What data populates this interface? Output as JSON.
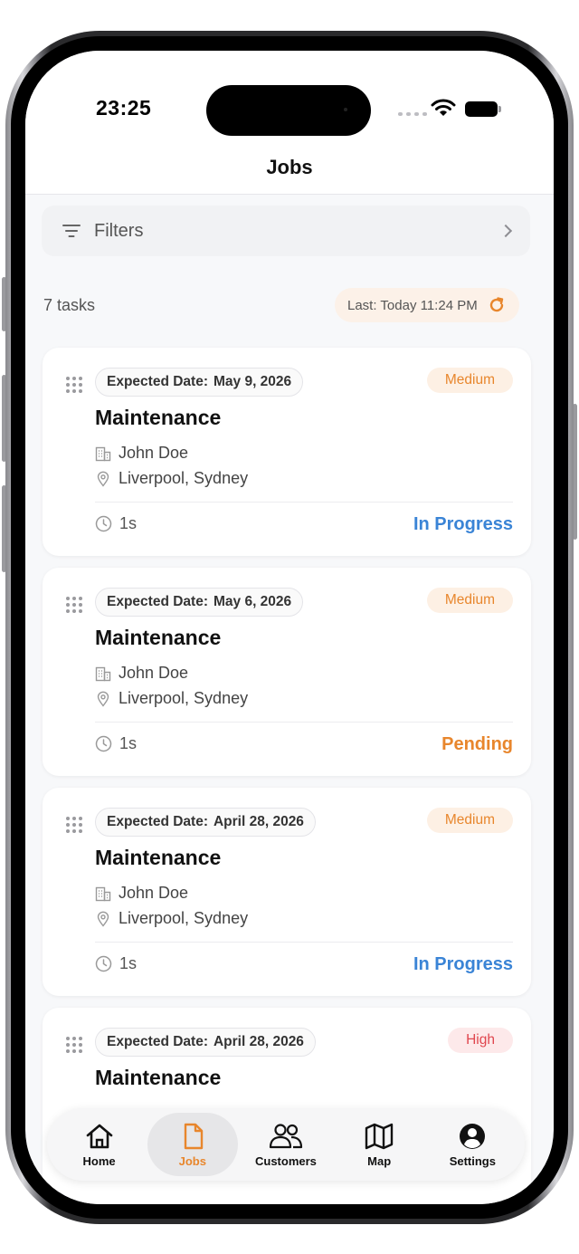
{
  "status_bar": {
    "time": "23:25"
  },
  "nav": {
    "title": "Jobs"
  },
  "filters": {
    "label": "Filters"
  },
  "summary": {
    "task_count": "7 tasks",
    "last_refresh": "Last: Today 11:24 PM"
  },
  "cards": [
    {
      "date_label": "Expected Date:",
      "date_value": "May 9, 2026",
      "priority": "Medium",
      "title": "Maintenance",
      "customer": "John Doe",
      "location": "Liverpool, Sydney",
      "duration": "1s",
      "status": "In Progress"
    },
    {
      "date_label": "Expected Date:",
      "date_value": "May 6, 2026",
      "priority": "Medium",
      "title": "Maintenance",
      "customer": "John Doe",
      "location": "Liverpool, Sydney",
      "duration": "1s",
      "status": "Pending"
    },
    {
      "date_label": "Expected Date:",
      "date_value": "April 28, 2026",
      "priority": "Medium",
      "title": "Maintenance",
      "customer": "John Doe",
      "location": "Liverpool, Sydney",
      "duration": "1s",
      "status": "In Progress"
    },
    {
      "date_label": "Expected Date:",
      "date_value": "April 28, 2026",
      "priority": "High",
      "title": "Maintenance"
    }
  ],
  "tabs": [
    {
      "label": "Home",
      "icon": "house-icon"
    },
    {
      "label": "Jobs",
      "icon": "document-icon",
      "active": true
    },
    {
      "label": "Customers",
      "icon": "people-icon"
    },
    {
      "label": "Map",
      "icon": "map-icon"
    },
    {
      "label": "Settings",
      "icon": "person-circle-icon"
    }
  ],
  "colors": {
    "accent": "#e8862c",
    "in_progress": "#3a84d6",
    "high": "#e0464e"
  }
}
